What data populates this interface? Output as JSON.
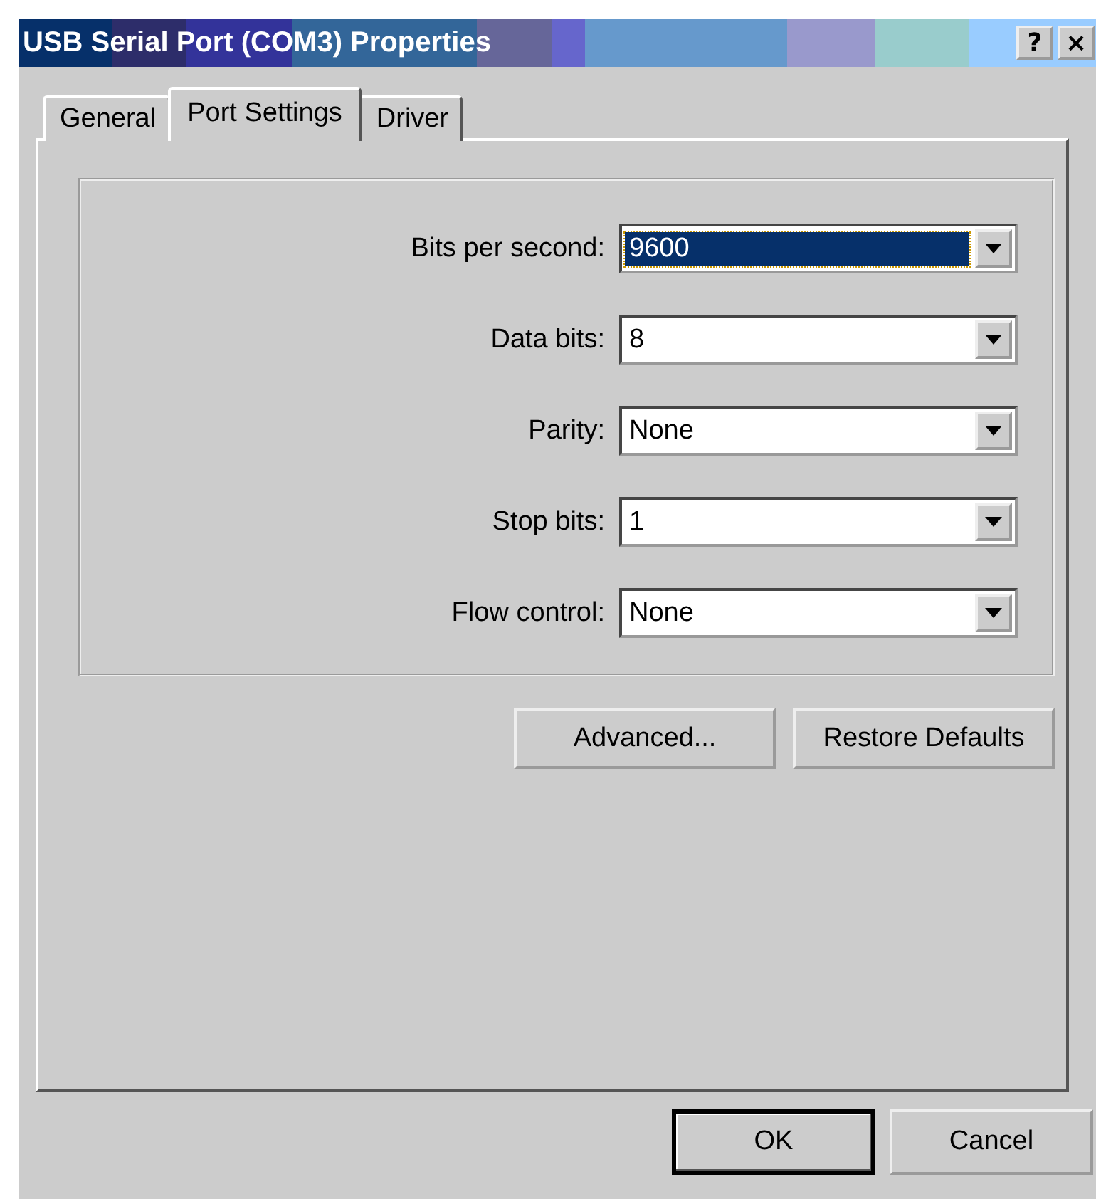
{
  "window": {
    "title": "USB Serial Port (COM3) Properties",
    "title_buttons": [
      "?",
      "×"
    ]
  },
  "tabs": [
    {
      "label": "General",
      "selected": false
    },
    {
      "label": "Port Settings",
      "selected": true
    },
    {
      "label": "Driver",
      "selected": false
    }
  ],
  "settings": [
    {
      "label": "Bits per second:",
      "value": "9600",
      "focused": true
    },
    {
      "label": "Data bits:",
      "value": "8",
      "focused": false
    },
    {
      "label": "Parity:",
      "value": "None",
      "focused": false
    },
    {
      "label": "Stop bits:",
      "value": "1",
      "focused": false
    },
    {
      "label": "Flow control:",
      "value": "None",
      "focused": false
    }
  ],
  "panel_buttons": [
    "Advanced...",
    "Restore Defaults"
  ],
  "dialog_buttons": [
    {
      "label": "OK",
      "default": true
    },
    {
      "label": "Cancel",
      "default": false
    }
  ]
}
